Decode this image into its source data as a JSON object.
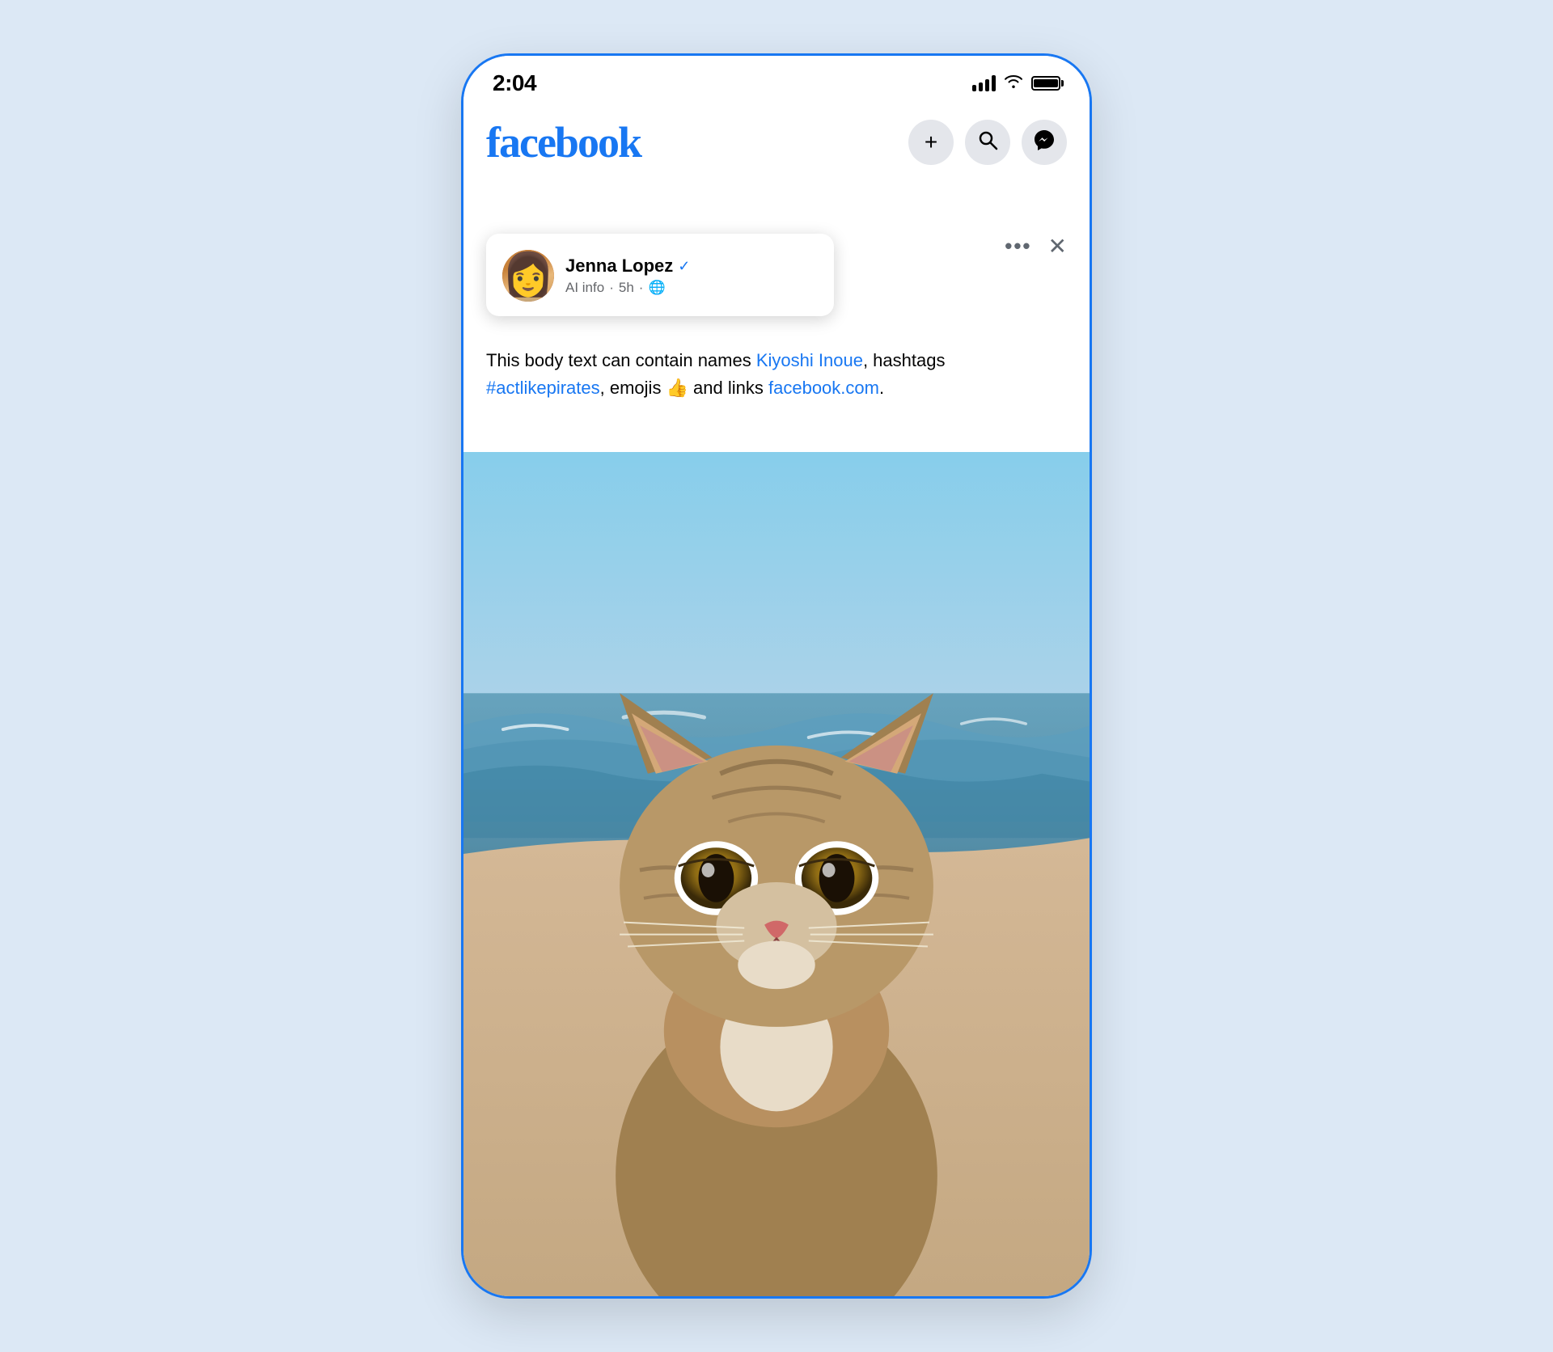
{
  "page": {
    "background_color": "#dce8f5"
  },
  "status_bar": {
    "time": "2:04",
    "signal_label": "signal",
    "wifi_label": "wifi",
    "battery_label": "battery"
  },
  "header": {
    "logo": "facebook",
    "add_button_label": "+",
    "search_button_label": "🔍",
    "messenger_button_label": "💬"
  },
  "post": {
    "user_name": "Jenna Lopez",
    "verified": true,
    "ai_info": "AI info",
    "time": "5h",
    "globe": "🌐",
    "body_text_prefix": "This body text can contain names ",
    "mention": "Kiyoshi Inoue",
    "body_text_mid": ", hashtags ",
    "hashtag": "#actlikepirates",
    "body_text_mid2": ", emojis 👍 and links ",
    "link": "facebook.com",
    "body_text_suffix": ".",
    "more_button": "•••",
    "close_button": "×"
  },
  "image": {
    "alt": "Cat sitting by the beach"
  }
}
